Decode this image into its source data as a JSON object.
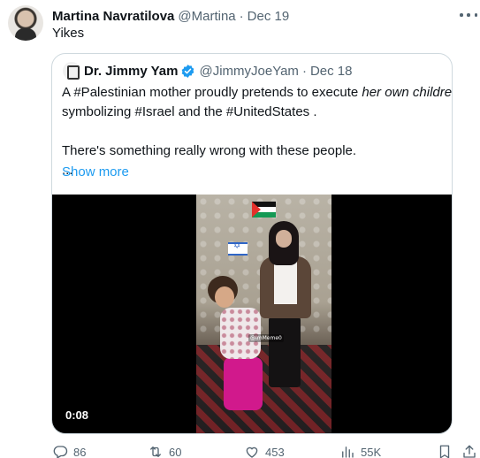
{
  "tweet": {
    "author_name": "Martina Navratilova",
    "author_handle": "@Martina",
    "separator": "·",
    "date": "Dec 19",
    "text": "Yikes",
    "more_icon": "more-horizontal-icon"
  },
  "quote": {
    "author_name": "Dr. Jimmy Yam",
    "verified_icon": "verified-badge-icon",
    "author_handle": "@JimmyJoeYam",
    "separator": "·",
    "date": "Dec 18",
    "line1_a": "A #Palestinian mother proudly pretends to execute ",
    "line1_em": "her own children",
    "line1_b": ",",
    "line2": "symbolizing #Israel and the #UnitedStates .",
    "line3": "There's something really wrong with these people.",
    "line4": "...",
    "show_more": "Show more"
  },
  "video": {
    "duration": "0:08",
    "watermark": "@ImMeme0"
  },
  "actions": {
    "replies": "86",
    "retweets": "60",
    "likes": "453",
    "views": "55K"
  },
  "colors": {
    "link": "#1d9bf0",
    "muted": "#536471",
    "text": "#0f1419",
    "border": "#cfd9de"
  }
}
